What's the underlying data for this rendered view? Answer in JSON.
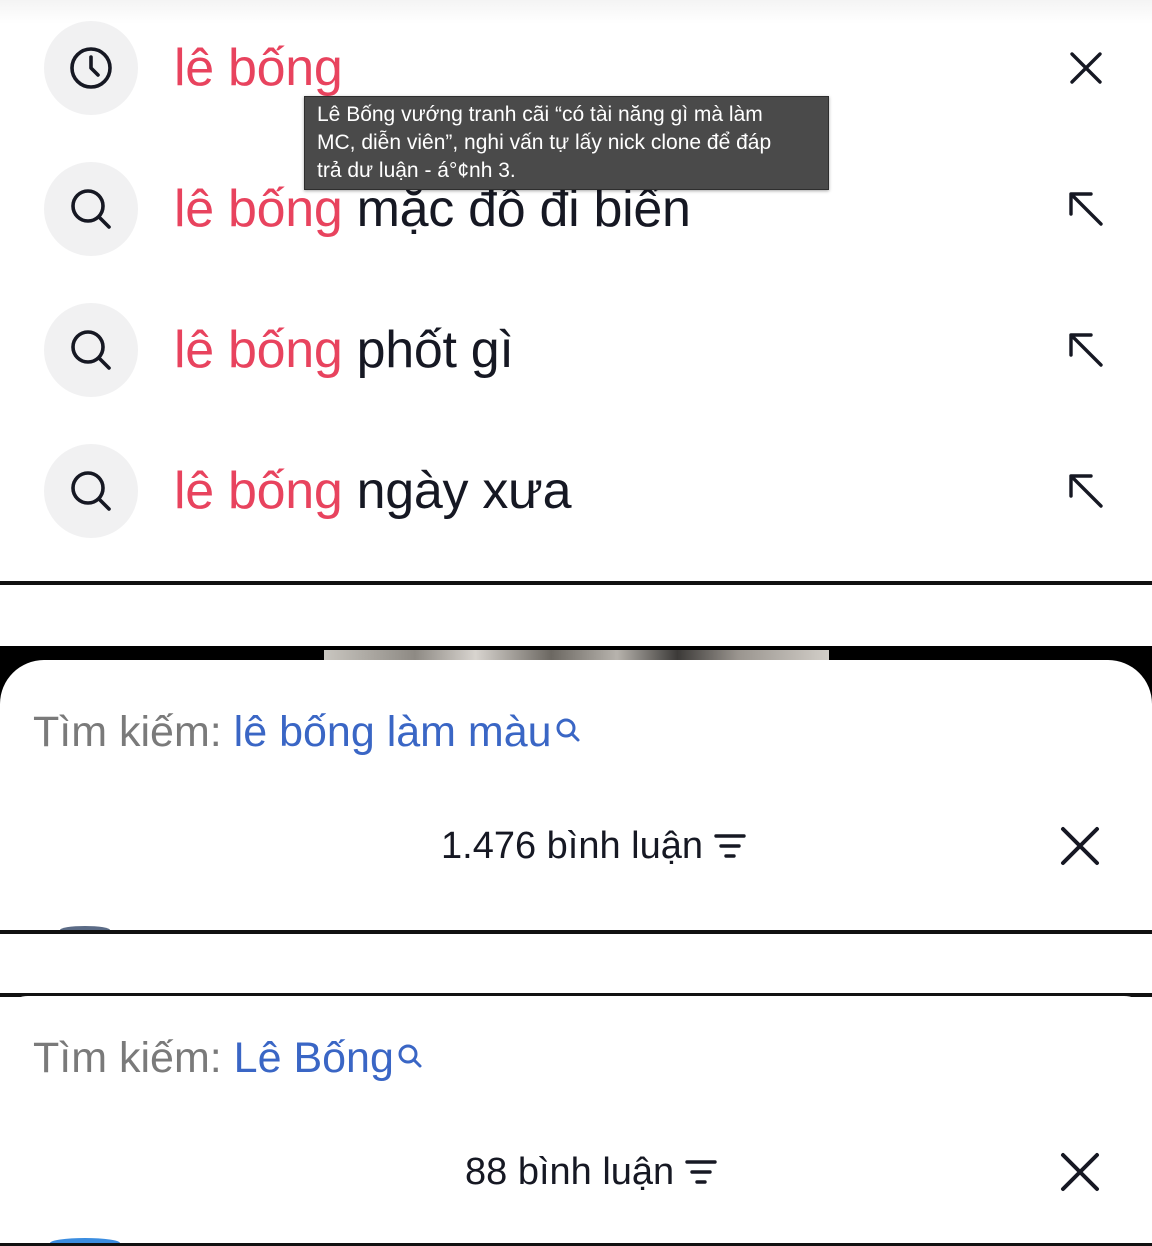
{
  "suggestions": {
    "items": [
      {
        "icon": "clock-icon",
        "highlight": "lê bống",
        "rest": "",
        "action": "close-icon"
      },
      {
        "icon": "search-icon",
        "highlight": "lê bống",
        "rest": " mặc đồ đi biển",
        "action": "arrow-up-left-icon"
      },
      {
        "icon": "search-icon",
        "highlight": "lê bống",
        "rest": " phốt gì",
        "action": "arrow-up-left-icon"
      },
      {
        "icon": "search-icon",
        "highlight": "lê bống",
        "rest": " ngày xưa",
        "action": "arrow-up-left-icon"
      }
    ],
    "tooltip": "Lê Bống vướng tranh cãi “có tài năng gì mà làm\nMC, diễn viên”, nghi vấn tự lấy nick clone để đáp\ntrả dư luận - á°¢nh 3."
  },
  "sheet1": {
    "search_prefix": "Tìm kiếm:",
    "search_query": "lê bống làm màu",
    "comment_count": "1.476 bình luận"
  },
  "sheet2": {
    "search_prefix": "Tìm kiếm:",
    "search_query": "Lê Bống",
    "comment_count": "88 bình luận"
  },
  "colors": {
    "highlight": "#e8435e",
    "query_link": "#3a66c5",
    "text": "#161823",
    "muted": "#7a7a7a",
    "tooltip_bg": "#4a4a4a"
  }
}
